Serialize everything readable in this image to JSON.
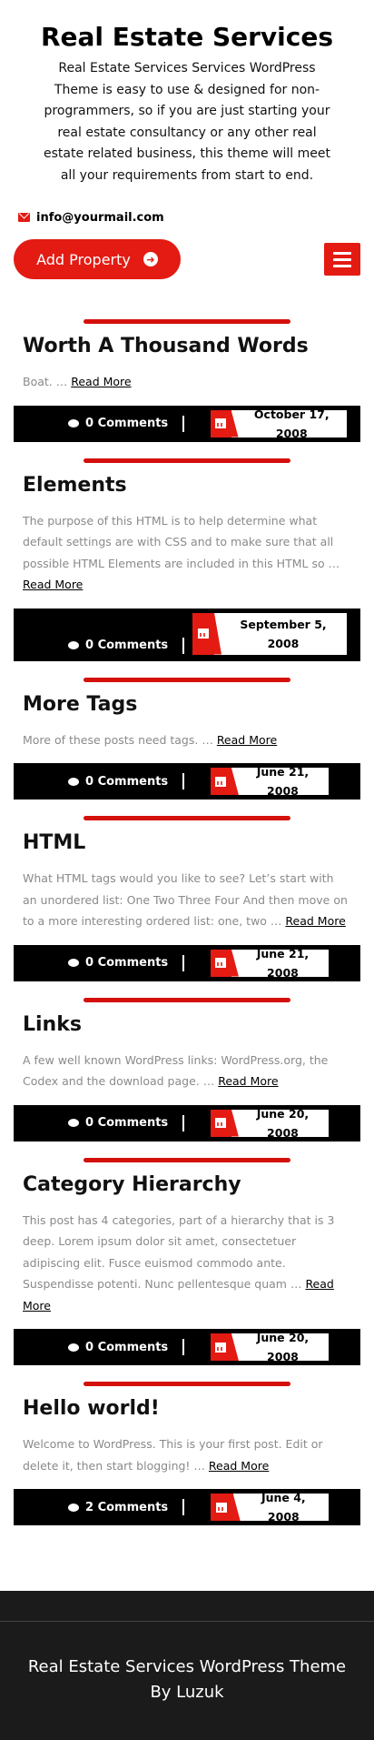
{
  "header": {
    "title": "Real Estate Services",
    "description": "Real Estate Services Services WordPress Theme is easy to use & designed for non-programmers, so if you are just starting your real estate consultancy or any other real estate related business, this theme will meet all your requirements from start to end."
  },
  "contact": {
    "email": "info@yourmail.com",
    "icon": "mail-icon"
  },
  "actions": {
    "add_property_label": "Add Property",
    "menu_icon": "hamburger-icon"
  },
  "posts": [
    {
      "title": "Worth A Thousand Words",
      "excerpt": "Boat. …",
      "read_more": "Read More",
      "comments": "0 Comments",
      "date": "October 17, 2008"
    },
    {
      "title": "Elements",
      "excerpt": "The purpose of this HTML is to help determine what default settings are with CSS and to make sure that all possible HTML Elements are included in this HTML so …",
      "read_more": "Read More",
      "comments": "0 Comments",
      "date": "September 5, 2008"
    },
    {
      "title": "More Tags",
      "excerpt": "More of these posts need tags. …",
      "read_more": "Read More",
      "comments": "0 Comments",
      "date": "June 21, 2008"
    },
    {
      "title": "HTML",
      "excerpt": "What HTML tags would you like to see? Let’s start with an unordered list: One Two Three Four And then move on to a more interesting ordered list: one, two …",
      "read_more": "Read More",
      "comments": "0 Comments",
      "date": "June 21, 2008"
    },
    {
      "title": "Links",
      "excerpt": "A few well known WordPress links: WordPress.org, the Codex and the download page. …",
      "read_more": "Read More",
      "comments": "0 Comments",
      "date": "June 20, 2008"
    },
    {
      "title": "Category Hierarchy",
      "excerpt": "This post has 4 categories, part of a hierarchy that is 3 deep. Lorem ipsum dolor sit amet, consectetuer adipiscing elit. Fusce euismod commodo ante. Suspendisse potenti. Nunc pellentesque quam …",
      "read_more": "Read More",
      "comments": "0 Comments",
      "date": "June 20, 2008"
    },
    {
      "title": "Hello world!",
      "excerpt": "Welcome to WordPress. This is your first post. Edit or delete it, then start blogging! …",
      "read_more": "Read More",
      "comments": "2 Comments",
      "date": "June 4, 2008"
    }
  ],
  "footer": {
    "text": "Real Estate Services WordPress Theme By Luzuk"
  },
  "colors": {
    "accent": "#e31b13",
    "bar": "#d4100b",
    "meta_bg": "#000000",
    "footer_bg": "#1b1b1b"
  }
}
